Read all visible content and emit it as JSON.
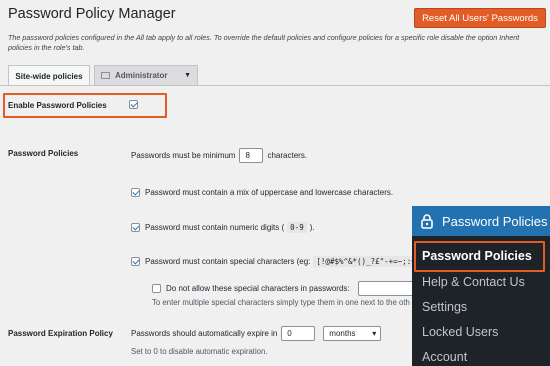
{
  "page": {
    "title": "Password Policy Manager",
    "reset_button": "Reset All Users' Passwords",
    "intro": "The password policies configured in the All tab apply to all roles. To override the default policies and configure policies for a specific role disable the option Inherit policies in the role's tab."
  },
  "tabs": {
    "active": "Site-wide policies",
    "role_select": "Administrator"
  },
  "enable": {
    "label": "Enable Password Policies",
    "checked": true
  },
  "policies": {
    "label": "Password Policies",
    "min_length_prefix": "Passwords must be minimum",
    "min_length_value": "8",
    "min_length_suffix": "characters.",
    "mix_case": "Password must contain a mix of uppercase and lowercase characters.",
    "digits_text": "Password must contain numeric digits (",
    "digits_code": "0-9",
    "digits_close": ").",
    "special_text": "Password must contain special characters (eg:",
    "special_code": "[!@#$%^&*()_?£\"-+=~;:€",
    "disallow_text": "Do not allow these special characters in passwords:",
    "disallow_hint": "To enter multiple special characters simply type them in one next to the oth"
  },
  "expiration": {
    "label": "Password Expiration Policy",
    "prefix": "Passwords should automatically expire in",
    "value": "0",
    "unit": "months",
    "hint": "Set to 0 to disable automatic expiration."
  },
  "admin_menu": {
    "header": "Password Policies",
    "items": [
      "Password Policies",
      "Help & Contact Us",
      "Settings",
      "Locked Users",
      "Account"
    ]
  },
  "colors": {
    "accent": "#e25c25",
    "menu_bg": "#1d2327",
    "menu_header": "#2271b1"
  }
}
